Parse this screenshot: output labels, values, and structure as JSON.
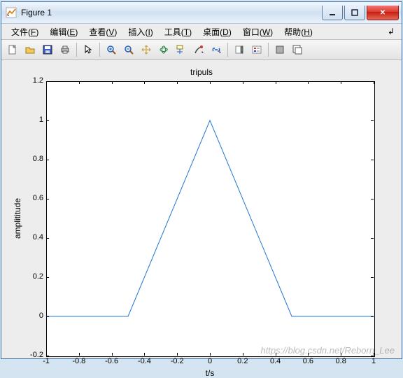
{
  "window": {
    "title": "Figure 1"
  },
  "menu": {
    "file": {
      "label": "文件",
      "accel": "F"
    },
    "edit": {
      "label": "编辑",
      "accel": "E"
    },
    "view": {
      "label": "查看",
      "accel": "V"
    },
    "insert": {
      "label": "插入",
      "accel": "I"
    },
    "tools": {
      "label": "工具",
      "accel": "T"
    },
    "desktop": {
      "label": "桌面",
      "accel": "D"
    },
    "windowm": {
      "label": "窗口",
      "accel": "W"
    },
    "help": {
      "label": "帮助",
      "accel": "H"
    }
  },
  "toolbar_icons": {
    "new": "new",
    "open": "open",
    "save": "save",
    "print": "print",
    "pointer": "pointer",
    "zoomin": "zoom-in",
    "zoomout": "zoom-out",
    "pan": "pan",
    "rotate3d": "rotate",
    "datacursor": "datatip",
    "brush": "brush",
    "link": "link",
    "colorbar": "colorbar",
    "legend": "legend",
    "hide": "hide",
    "overlay": "overlay"
  },
  "chart_data": {
    "type": "line",
    "title": "tripuls",
    "xlabel": "t/s",
    "ylabel": "amplititude",
    "xlim": [
      -1,
      1
    ],
    "ylim": [
      -0.2,
      1.2
    ],
    "xticks": [
      -1,
      -0.8,
      -0.6,
      -0.4,
      -0.2,
      0,
      0.2,
      0.4,
      0.6,
      0.8,
      1
    ],
    "yticks": [
      -0.2,
      0,
      0.2,
      0.4,
      0.6,
      0.8,
      1,
      1.2
    ],
    "series": [
      {
        "name": "tripuls",
        "color": "#1f77d0",
        "x": [
          -1,
          -0.5,
          0,
          0.5,
          1
        ],
        "y": [
          0,
          0,
          1,
          0,
          0
        ]
      }
    ]
  },
  "watermark": "https://blog.csdn.net/Reborn_Lee"
}
